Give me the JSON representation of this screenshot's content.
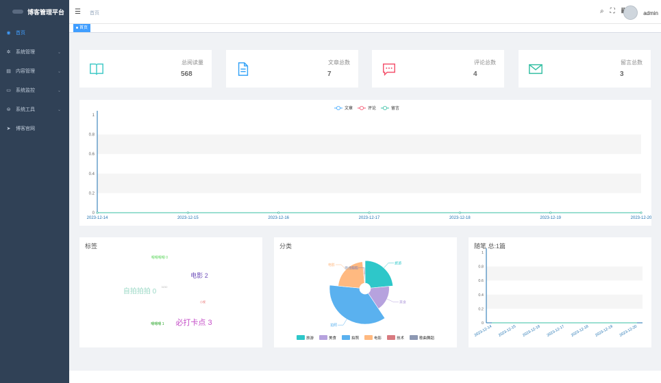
{
  "app": {
    "title": "博客管理平台"
  },
  "sidebar": {
    "items": [
      {
        "label": "首页",
        "icon": "dashboard-icon",
        "active": true,
        "arrow": ""
      },
      {
        "label": "系统管理",
        "icon": "gear-icon",
        "arrow": "⌄"
      },
      {
        "label": "内容管理",
        "icon": "document-icon",
        "arrow": "⌄"
      },
      {
        "label": "系统监控",
        "icon": "monitor-icon",
        "arrow": "⌄"
      },
      {
        "label": "系统工具",
        "icon": "tool-icon",
        "arrow": "⌄"
      },
      {
        "label": "博客官网",
        "icon": "send-icon",
        "arrow": ""
      }
    ]
  },
  "header": {
    "breadcrumb": "首页",
    "username": "admin",
    "icons": [
      "search-icon",
      "fullscreen-icon",
      "font-size-icon"
    ]
  },
  "tags": {
    "active": "首页"
  },
  "stats": [
    {
      "label": "总阅读量",
      "value": "568",
      "icon": "book-icon",
      "color": "#40c9c6"
    },
    {
      "label": "文章总数",
      "value": "7",
      "icon": "file-text-icon",
      "color": "#36a3f7"
    },
    {
      "label": "评论总数",
      "value": "4",
      "icon": "message-icon",
      "color": "#f4516c"
    },
    {
      "label": "留言总数",
      "value": "3",
      "icon": "mail-icon",
      "color": "#34bfa3"
    }
  ],
  "panels": {
    "tags_title": "标签",
    "category_title": "分类",
    "notes_title": "随笔 总:1篇"
  },
  "chart_data": [
    {
      "type": "line",
      "legend": [
        "文章",
        "评论",
        "留言"
      ],
      "legend_colors": [
        "#40a9ff",
        "#f4516c",
        "#34bfa3"
      ],
      "x": [
        "2023-12-14",
        "2023-12-15",
        "2023-12-16",
        "2023-12-17",
        "2023-12-18",
        "2023-12-19",
        "2023-12-20"
      ],
      "series": [
        {
          "name": "文章",
          "values": [
            0,
            0,
            0,
            0,
            0,
            0,
            0
          ]
        },
        {
          "name": "评论",
          "values": [
            0,
            0,
            0,
            0,
            0,
            0,
            0
          ]
        },
        {
          "name": "留言",
          "values": [
            0,
            0,
            0,
            0,
            0,
            0,
            0
          ]
        }
      ],
      "yticks": [
        "0",
        "0.2",
        "0.4",
        "0.6",
        "0.8",
        "1"
      ],
      "ylim": [
        0,
        1
      ],
      "legend_position": "top-center"
    },
    {
      "type": "wordcloud",
      "words": [
        {
          "text": "嗯嗯嗯嗯 0",
          "color": "#5cd65c",
          "size": 5
        },
        {
          "text": "电影 2",
          "color": "#6b4bb8",
          "size": 9
        },
        {
          "text": "自拍拍拍 0",
          "color": "#9ad8c5",
          "size": 10
        },
        {
          "text": "3232",
          "color": "#b7b7b7",
          "size": 4
        },
        {
          "text": "小视",
          "color": "#e86a6a",
          "size": 4
        },
        {
          "text": "嗯嗯嗯 1",
          "color": "#1a9e1a",
          "size": 5
        },
        {
          "text": "必打卡点 3",
          "color": "#c54fc8",
          "size": 11
        }
      ]
    },
    {
      "type": "pie",
      "title": "分类",
      "slices": [
        {
          "name": "旅游",
          "value": 1.5,
          "color": "#2ec7c9"
        },
        {
          "name": "美食",
          "value": 1.1,
          "color": "#b6a2de"
        },
        {
          "name": "拍照",
          "value": 2.3,
          "color": "#5ab1ef"
        },
        {
          "name": "电影",
          "value": 1.4,
          "color": "#ffb980"
        },
        {
          "name": "技术",
          "value": 0.05,
          "color": "#d87a80"
        },
        {
          "name": "歌曲舞蹈",
          "value": 0.05,
          "color": "#8d98b3"
        }
      ],
      "legend_position": "bottom"
    },
    {
      "type": "line",
      "title": "随笔 总:1篇",
      "x": [
        "2023-12-14",
        "2023-12-15",
        "2023-12-16",
        "2023-12-17",
        "2023-12-18",
        "2023-12-19",
        "2023-12-20"
      ],
      "series": [
        {
          "values": [
            0,
            0,
            0,
            0,
            0,
            0,
            0
          ]
        }
      ],
      "yticks": [
        "0",
        "0.2",
        "0.4",
        "0.6",
        "0.8",
        "1"
      ],
      "ylim": [
        0,
        1
      ]
    }
  ]
}
